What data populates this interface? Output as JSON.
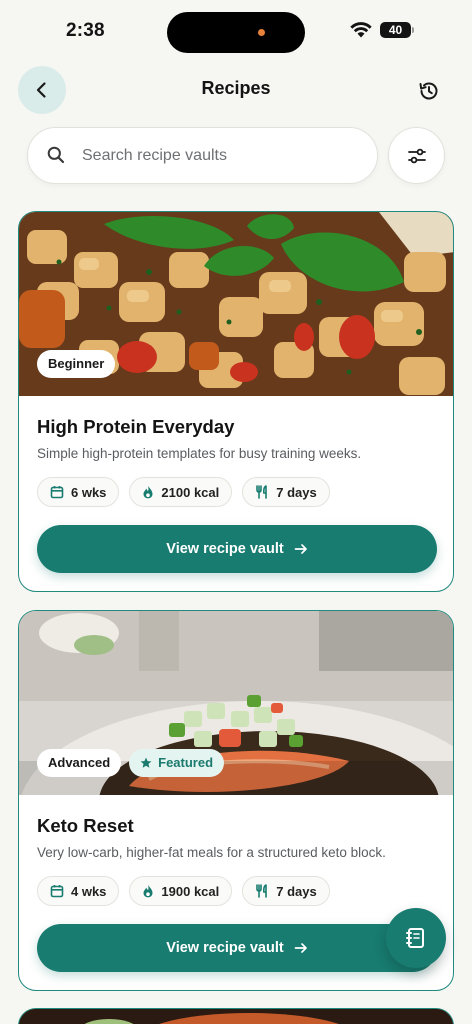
{
  "status_bar": {
    "time": "2:38",
    "battery": "40"
  },
  "header": {
    "title": "Recipes"
  },
  "search": {
    "placeholder": "Search recipe vaults"
  },
  "recipes": [
    {
      "level": "Beginner",
      "featured": null,
      "title": "High Protein Everyday",
      "description": "Simple high-protein templates for busy training weeks.",
      "duration": "6 wks",
      "calories": "2100 kcal",
      "days": "7 days",
      "cta": "View recipe vault"
    },
    {
      "level": "Advanced",
      "featured": "Featured",
      "title": "Keto Reset",
      "description": "Very low-carb, higher-fat meals for a structured keto block.",
      "duration": "4 wks",
      "calories": "1900 kcal",
      "days": "7 days",
      "cta": "View recipe vault"
    }
  ],
  "colors": {
    "accent": "#187c70",
    "border": "#1f8a7d",
    "back_bg": "#d9ece9",
    "featured_bg": "#e4f4f0"
  },
  "icons": {
    "back": "chevron-left-icon",
    "history": "history-icon",
    "search": "search-icon",
    "filter": "sliders-icon",
    "duration": "calendar-icon",
    "calories": "flame-icon",
    "days": "utensils-icon",
    "featured": "star-icon",
    "cta": "arrow-right-icon",
    "fab": "notebook-icon"
  }
}
